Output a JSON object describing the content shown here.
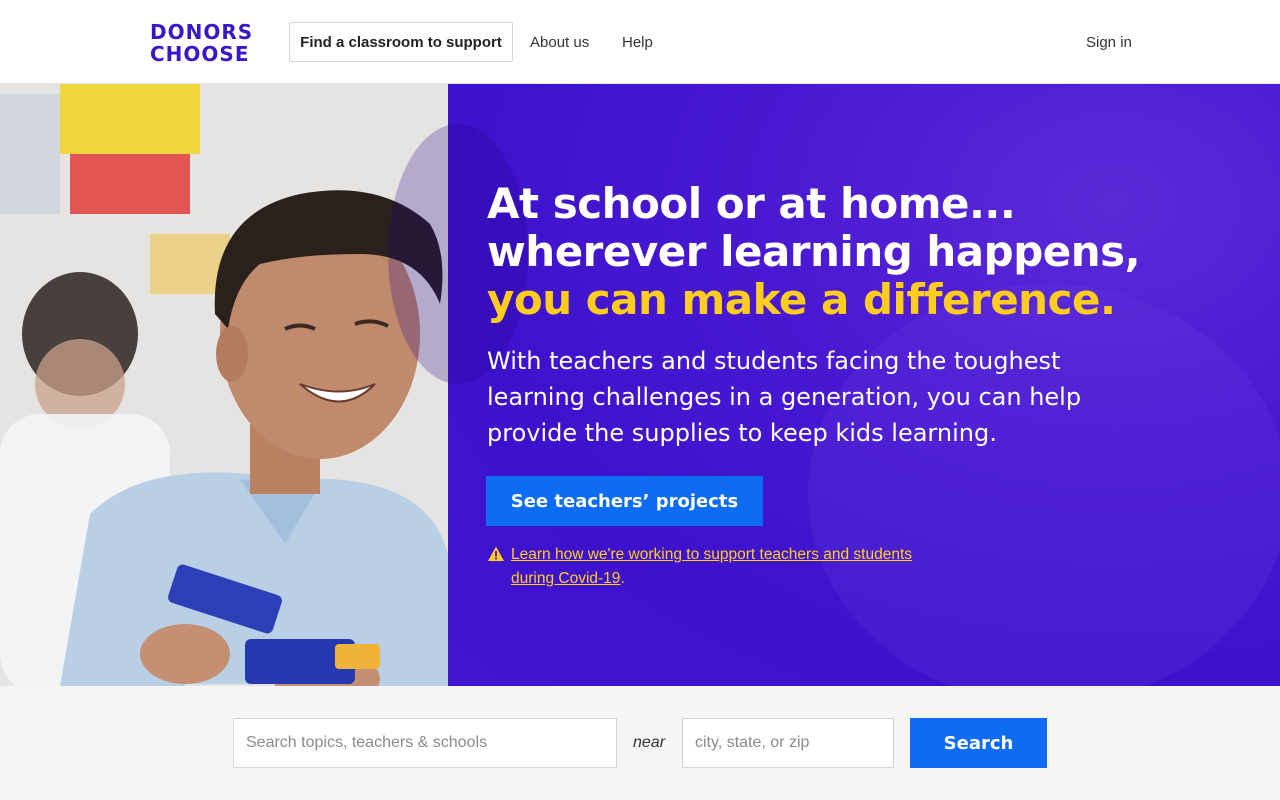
{
  "header": {
    "logo_line1": "DONORS",
    "logo_line2": "CHOOSE",
    "nav_find": "Find a classroom to support",
    "nav_about": "About us",
    "nav_help": "Help",
    "nav_signin": "Sign in"
  },
  "hero": {
    "headline_line1": "At school or at home...",
    "headline_line2": "wherever learning happens,",
    "headline_accent": "you can make a difference.",
    "subhead": "With teachers and students facing the toughest learning challenges in a generation, you can help provide the supplies to keep kids learning.",
    "cta_label": "See teachers’ projects",
    "covid_link": "Learn how we're working to support teachers and students during Covid-19",
    "covid_period": ".",
    "warning_icon": "warning-icon",
    "photo_alt": "child playing with blocks"
  },
  "search": {
    "topic_placeholder": "Search topics, teachers & schools",
    "near_label": "near",
    "location_placeholder": "city, state, or zip",
    "button_label": "Search"
  },
  "colors": {
    "brand_purple": "#3a16c9",
    "hero_purple": "#4a19d2",
    "accent_yellow": "#ffcd1f",
    "button_blue": "#0d6cf2"
  }
}
